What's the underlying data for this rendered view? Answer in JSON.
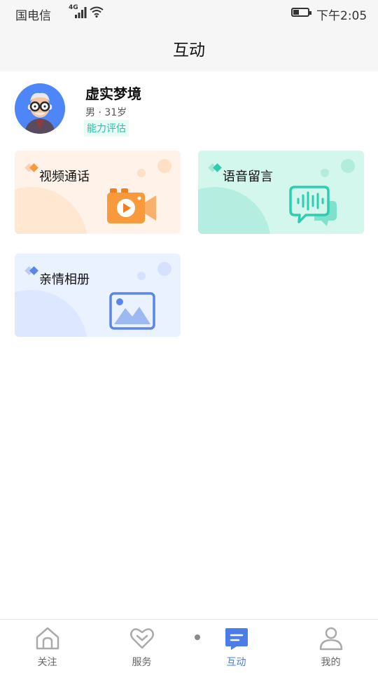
{
  "status_bar": {
    "carrier": "国电信",
    "network": "4G",
    "time": "下午2:05"
  },
  "header": {
    "title": "互动"
  },
  "profile": {
    "name": "虚实梦境",
    "meta": "男 · 31岁",
    "ability_label": "能力评估"
  },
  "cards": [
    {
      "label": "视频通话",
      "icon": "video-camera-icon",
      "accent": "#f89a3c"
    },
    {
      "label": "语音留言",
      "icon": "voice-message-icon",
      "accent": "#2dcdb2"
    },
    {
      "label": "亲情相册",
      "icon": "photo-album-icon",
      "accent": "#5a86e8"
    }
  ],
  "tabbar": {
    "items": [
      {
        "label": "关注",
        "icon": "home-icon"
      },
      {
        "label": "服务",
        "icon": "heart-icon"
      },
      {
        "label": "互动",
        "icon": "chat-icon",
        "active": true
      },
      {
        "label": "我的",
        "icon": "user-icon"
      }
    ]
  },
  "colors": {
    "active": "#4a7de8",
    "inactive": "#666666",
    "teal": "#19c7a9"
  }
}
